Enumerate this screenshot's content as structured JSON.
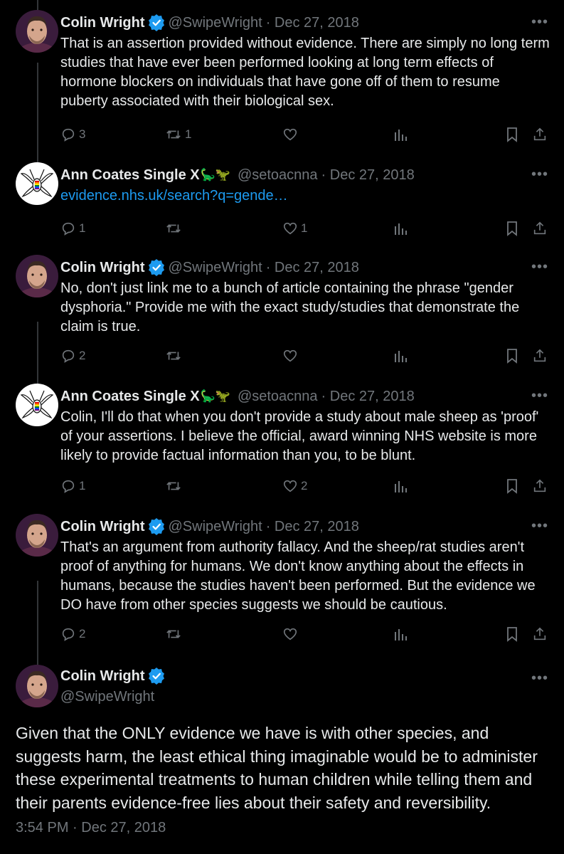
{
  "colors": {
    "background": "#000000",
    "text": "#e7e9ea",
    "secondary": "#71767b",
    "link": "#1d9bf0",
    "verified": "#1d9bf0"
  },
  "tweets": [
    {
      "name": "Colin Wright",
      "handle": "@SwipeWright",
      "date": "· Dec 27, 2018",
      "text": "That is an assertion provided without evidence. There are simply no long term studies that have ever been performed looking at long term effects of hormone blockers on individuals that have gone off of them to resume puberty associated with their biological sex.",
      "replies": "3",
      "reposts": "1",
      "likes": ""
    },
    {
      "name": "Ann Coates Single X",
      "emoji": "🦕🦖",
      "handle": "@setoacnna",
      "date": "· Dec 27, 2018",
      "text": "evidence.nhs.uk/search?q=gende…",
      "replies": "1",
      "reposts": "",
      "likes": "1"
    },
    {
      "name": "Colin Wright",
      "handle": "@SwipeWright",
      "date": "· Dec 27, 2018",
      "text": "No, don't just link me to a bunch of article containing the phrase \"gender dysphoria.\" Provide me with the exact study/studies that demonstrate the claim is true.",
      "replies": "2",
      "reposts": "",
      "likes": ""
    },
    {
      "name": "Ann Coates Single X",
      "emoji": "🦕🦖",
      "handle": "@setoacnna",
      "date": "· Dec 27, 2018",
      "text": "Colin, I'll do that when you don't provide a study about male sheep as 'proof' of your assertions. I believe the official, award winning NHS website is more likely to provide factual information than you, to be blunt.",
      "replies": "1",
      "reposts": "",
      "likes": "2"
    },
    {
      "name": "Colin Wright",
      "handle": "@SwipeWright",
      "date": "· Dec 27, 2018",
      "text": "That's an argument from authority fallacy. And the sheep/rat studies aren't proof of anything for humans. We don't know anything about the effects in humans, because the studies haven't been performed. But the evidence we DO have from other species suggests we should be cautious.",
      "replies": "2",
      "reposts": "",
      "likes": ""
    }
  ],
  "main_tweet": {
    "name": "Colin Wright",
    "handle": "@SwipeWright",
    "text": "Given that the ONLY evidence we have is with other species, and suggests harm, the least ethical thing imaginable would be to administer these experimental treatments to human children while telling them and their parents evidence-free lies about their safety and reversibility.",
    "timestamp": "3:54 PM · Dec 27, 2018"
  },
  "icons": {
    "more": "more-icon",
    "reply": "reply-icon",
    "repost": "repost-icon",
    "like": "like-icon",
    "views": "views-icon",
    "bookmark": "bookmark-icon",
    "share": "share-icon",
    "verified": "verified-badge-icon"
  }
}
